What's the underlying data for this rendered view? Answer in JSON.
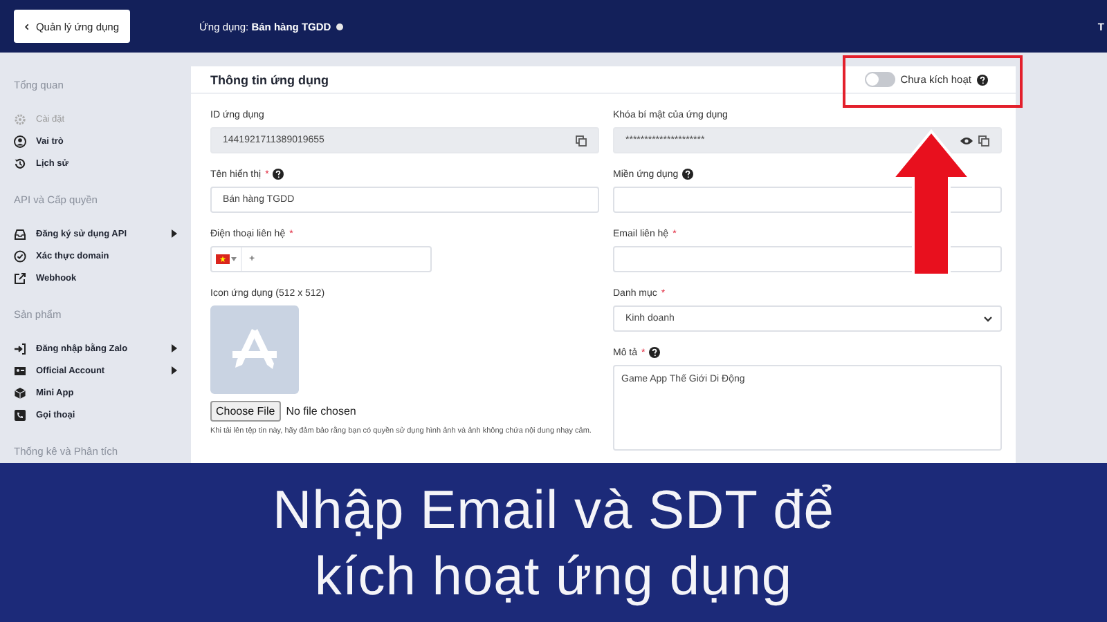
{
  "header": {
    "back_button": "Quản lý ứng dụng",
    "app_label": "Ứng dụng:",
    "app_name": "Bán hàng TGDD",
    "edge_text": "T"
  },
  "sidebar": {
    "sections": [
      {
        "title": "Tổng quan",
        "items": [
          {
            "label": "Cài đặt",
            "disabled": true,
            "has_submenu": false
          },
          {
            "label": "Vai trò",
            "disabled": false,
            "has_submenu": false
          },
          {
            "label": "Lịch sử",
            "disabled": false,
            "has_submenu": false
          }
        ]
      },
      {
        "title": "API và Cấp quyền",
        "items": [
          {
            "label": "Đăng ký sử dụng API",
            "disabled": false,
            "has_submenu": true
          },
          {
            "label": "Xác thực domain",
            "disabled": false,
            "has_submenu": false
          },
          {
            "label": "Webhook",
            "disabled": false,
            "has_submenu": false
          }
        ]
      },
      {
        "title": "Sản phẩm",
        "items": [
          {
            "label": "Đăng nhập bằng Zalo",
            "disabled": false,
            "has_submenu": true
          },
          {
            "label": "Official Account",
            "disabled": false,
            "has_submenu": true
          },
          {
            "label": "Mini App",
            "disabled": false,
            "has_submenu": false
          },
          {
            "label": "Gọi thoại",
            "disabled": false,
            "has_submenu": false
          }
        ]
      },
      {
        "title": "Thống kê và Phân tích"
      }
    ]
  },
  "card": {
    "title": "Thông tin ứng dụng",
    "status_toggle": {
      "label": "Chưa kích hoạt",
      "on": false
    },
    "columns": [
      [
        {
          "kind": "readonly",
          "label": "ID ứng dụng",
          "value": "1441921711389019655"
        },
        {
          "kind": "text",
          "label": "Tên hiển thị",
          "required_mark": "*",
          "help": true,
          "value": "Bán hàng TGDD"
        },
        {
          "kind": "phone",
          "label": "Điện thoại liên hệ",
          "required_mark": "*",
          "prefix": "+"
        },
        {
          "kind": "image",
          "label": "Icon ứng dụng (512 x 512)",
          "button": "Choose File",
          "status": "No file chosen",
          "note": "Khi tải lên tệp tin này, hãy đảm bảo rằng bạn có quyền sử dụng hình ảnh và ảnh không chứa nội dung nhạy cảm."
        }
      ],
      [
        {
          "kind": "secret",
          "label": "Khóa bí mật của ứng dụng",
          "value": "*********************"
        },
        {
          "kind": "text",
          "label": "Miền ứng dụng",
          "help": true
        },
        {
          "kind": "text",
          "label": "Email liên hệ",
          "required_mark": "*"
        },
        {
          "kind": "select",
          "label": "Danh mục",
          "required_mark": "*",
          "value": "Kinh doanh"
        },
        {
          "kind": "textarea",
          "label": "Mô tả",
          "required_mark": "*",
          "help": true,
          "value": "Game App Thế Giới Di Động"
        }
      ]
    ]
  },
  "caption": {
    "lines": [
      "Nhập Email và SDT để",
      "kích hoạt ứng dụng"
    ]
  }
}
